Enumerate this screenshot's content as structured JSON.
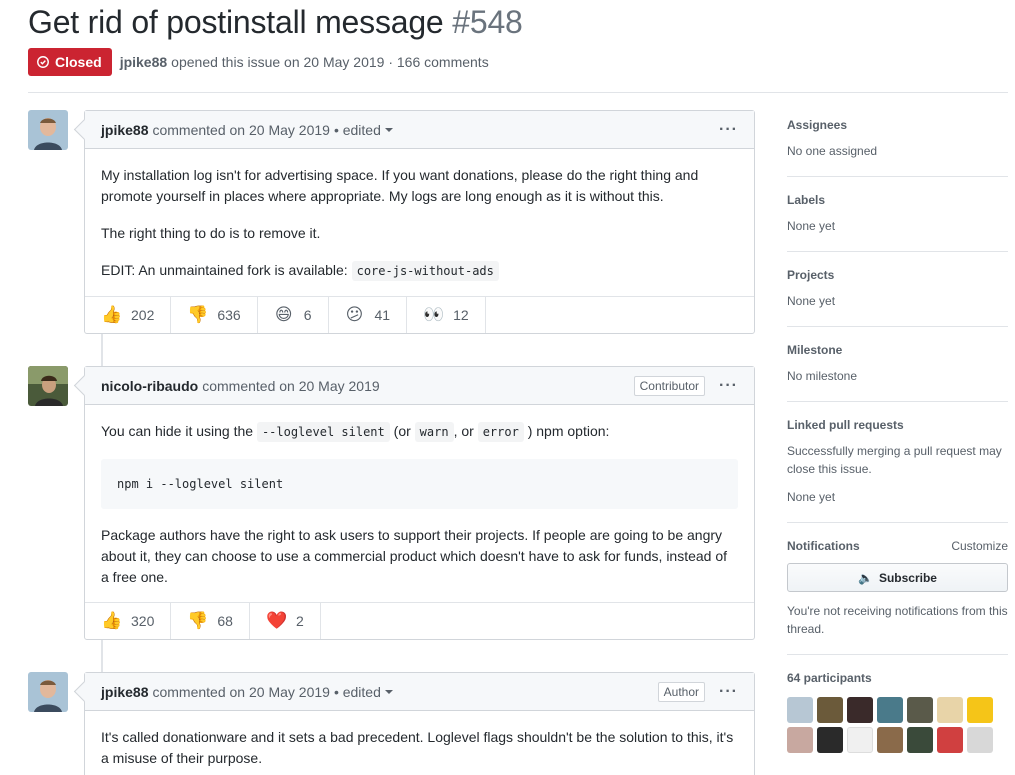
{
  "issue": {
    "title": "Get rid of postinstall message",
    "number": "#548",
    "state": "Closed",
    "author": "jpike88",
    "opened_text": "opened this issue on 20 May 2019 · 166 comments"
  },
  "comments": [
    {
      "author": "jpike88",
      "meta": "commented on 20 May 2019",
      "edited": "• edited",
      "role": "",
      "p1": "My installation log isn't for advertising space. If you want donations, please do the right thing and promote yourself in places where appropriate. My logs are long enough as it is without this.",
      "p2": "The right thing to do is to remove it.",
      "p3": "EDIT: An unmaintained fork is available:",
      "code": "core-js-without-ads",
      "reactions": [
        {
          "icon": "thumbs-up",
          "glyph": "👍",
          "count": "202"
        },
        {
          "icon": "thumbs-down",
          "glyph": "👎",
          "count": "636"
        },
        {
          "icon": "laugh",
          "glyph": "😄",
          "count": "6"
        },
        {
          "icon": "confused",
          "glyph": "😕",
          "count": "41"
        },
        {
          "icon": "eyes",
          "glyph": "👀",
          "count": "12"
        }
      ]
    },
    {
      "author": "nicolo-ribaudo",
      "meta": "commented on 20 May 2019",
      "role": "Contributor",
      "p1a": "You can hide it using the",
      "code1": "--loglevel silent",
      "p1b": "(or",
      "code2": "warn",
      "p1c": ", or",
      "code3": "error",
      "p1d": ") npm option:",
      "pre": "npm i --loglevel silent",
      "p2": "Package authors have the right to ask users to support their projects. If people are going to be angry about it, they can choose to use a commercial product which doesn't have to ask for funds, instead of a free one.",
      "reactions": [
        {
          "icon": "thumbs-up",
          "glyph": "👍",
          "count": "320"
        },
        {
          "icon": "thumbs-down",
          "glyph": "👎",
          "count": "68"
        },
        {
          "icon": "heart",
          "glyph": "❤️",
          "count": "2"
        }
      ]
    },
    {
      "author": "jpike88",
      "meta": "commented on 20 May 2019",
      "edited": "• edited",
      "role": "Author",
      "p1": "It's called donationware and it sets a bad precedent. Loglevel flags shouldn't be the solution to this, it's a misuse of their purpose."
    }
  ],
  "sidebar": {
    "assignees": {
      "label": "Assignees",
      "value": "No one assigned"
    },
    "labels": {
      "label": "Labels",
      "value": "None yet"
    },
    "projects": {
      "label": "Projects",
      "value": "None yet"
    },
    "milestone": {
      "label": "Milestone",
      "value": "No milestone"
    },
    "linked": {
      "label": "Linked pull requests",
      "desc": "Successfully merging a pull request may close this issue.",
      "value": "None yet"
    },
    "notifications": {
      "label": "Notifications",
      "customize": "Customize",
      "subscribe": "Subscribe",
      "note": "You're not receiving notifications from this thread."
    },
    "participants": {
      "label": "64 participants"
    }
  },
  "colors": {
    "closed": "#cb2431",
    "border": "#d1d5da",
    "muted": "#586069"
  }
}
